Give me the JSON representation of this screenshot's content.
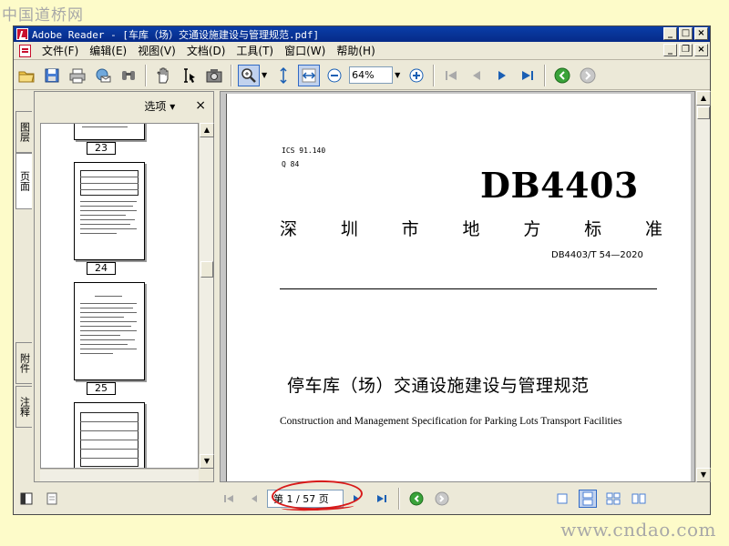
{
  "watermark": {
    "top": "中国道桥网",
    "bottom": "www.cndao.com"
  },
  "window": {
    "title": "Adobe Reader - [车库（场）交通设施建设与管理规范.pdf]",
    "controls": {
      "minimize": "_",
      "maximize": "□",
      "close": "×"
    },
    "doc_controls": {
      "minimize": "_",
      "restore": "❐",
      "close": "×"
    }
  },
  "menu": {
    "items": [
      "文件(F)",
      "编辑(E)",
      "视图(V)",
      "文档(D)",
      "工具(T)",
      "窗口(W)",
      "帮助(H)"
    ]
  },
  "toolbar": {
    "zoom_value": "64%",
    "icons": [
      "open-icon",
      "save-icon",
      "print-icon",
      "email-icon",
      "search-icon",
      "hand-icon",
      "select-text-icon",
      "snapshot-icon",
      "zoom-in-icon",
      "fit-page-icon",
      "fit-width-icon",
      "zoom-out-minus-icon",
      "zoom-in-plus-icon",
      "first-page-icon",
      "prev-page-icon",
      "next-page-icon",
      "last-page-icon",
      "back-icon",
      "forward-icon"
    ]
  },
  "side_tabs": {
    "layers": "图层",
    "pages": "页面",
    "attachments": "附件",
    "comments": "注释"
  },
  "nav_panel": {
    "options_label": "选项 ▾",
    "close": "×",
    "thumbnails": [
      {
        "label": "23"
      },
      {
        "label": "24"
      },
      {
        "label": "25"
      },
      {
        "label": ""
      }
    ]
  },
  "document": {
    "ics": "ICS 91.140",
    "q_code": "Q 84",
    "db_code": "DB4403",
    "standard_name_chars": [
      "深",
      "圳",
      "市",
      "地",
      "方",
      "标",
      "准"
    ],
    "standard_number": "DB4403/T 54—2020",
    "title": "停车库（场）交通设施建设与管理规范",
    "subtitle": "Construction and Management Specification for Parking Lots Transport Facilities"
  },
  "status": {
    "page_indicator": "第 1 / 57 页"
  },
  "colors": {
    "titlebar": "#0a3ea8",
    "background": "#fdfbc9",
    "annotation": "#d81a1a"
  }
}
